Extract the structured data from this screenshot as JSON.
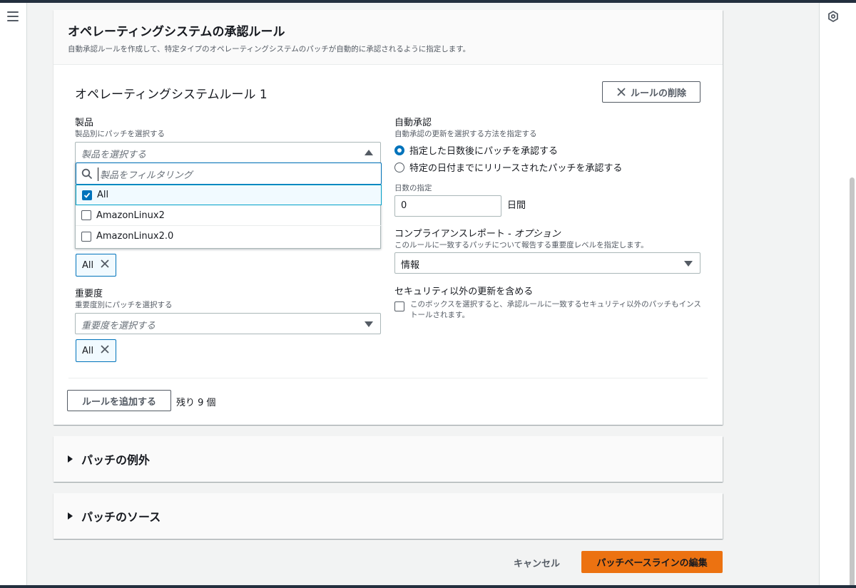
{
  "section": {
    "title": "オペレーティングシステムの承認ルール",
    "description": "自動承認ルールを作成して、特定タイプのオペレーティングシステムのパッチが自動的に承認されるように指定します。"
  },
  "rule": {
    "title": "オペレーティングシステムルール 1",
    "delete_label": "ルールの削除"
  },
  "product": {
    "label": "製品",
    "sublabel": "製品別にパッチを選択する",
    "placeholder": "製品を選択する",
    "filter_placeholder": "製品をフィルタリング",
    "options": [
      {
        "label": "All",
        "checked": true
      },
      {
        "label": "AmazonLinux2",
        "checked": false
      },
      {
        "label": "AmazonLinux2.0",
        "checked": false
      }
    ],
    "token": "All"
  },
  "severity": {
    "label": "重要度",
    "sublabel": "重要度別にパッチを選択する",
    "placeholder": "重要度を選択する",
    "token": "All"
  },
  "auto_approval": {
    "label": "自動承認",
    "sublabel": "自動承認の更新を選択する方法を指定する",
    "options": [
      {
        "label": "指定した日数後にパッチを承認する",
        "selected": true
      },
      {
        "label": "特定の日付までにリリースされたパッチを承認する",
        "selected": false
      }
    ],
    "days_label": "日数の指定",
    "days_value": "0",
    "days_unit": "日間"
  },
  "compliance": {
    "label": "コンプライアンスレポート - ",
    "label_optional": "オプション",
    "sublabel": "このルールに一致するパッチについて報告する重要度レベルを指定します。",
    "value": "情報"
  },
  "non_security": {
    "label": "セキュリティ以外の更新を含める",
    "checkbox_text": "このボックスを選択すると、承認ルールに一致するセキュリティ以外のパッチもインストールされます。",
    "checked": false
  },
  "add_rule": {
    "label": "ルールを追加する",
    "remaining": "残り 9 個"
  },
  "sections": {
    "exceptions": "パッチの例外",
    "sources": "パッチのソース"
  },
  "footer": {
    "cancel": "キャンセル",
    "submit": "パッチベースラインの編集"
  },
  "colors": {
    "primary": "#ec7211",
    "accent": "#0073bb"
  }
}
